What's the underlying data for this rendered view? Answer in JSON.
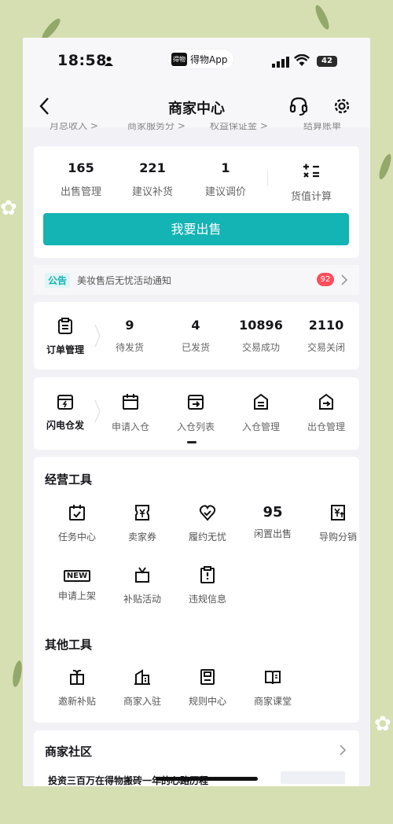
{
  "status_bar": {
    "time": "18:58",
    "app_label": "得物App",
    "app_logo": "得物",
    "battery": "42"
  },
  "nav": {
    "title": "商家中心"
  },
  "sublinks": [
    "月总收入 >",
    "商家服务分 >",
    "权益保证金 >",
    "结算账单"
  ],
  "stats": {
    "items": [
      {
        "value": "165",
        "label": "出售管理"
      },
      {
        "value": "221",
        "label": "建议补货"
      },
      {
        "value": "1",
        "label": "建议调价"
      }
    ],
    "calc_label": "货值计算",
    "primary_button": "我要出售"
  },
  "notice": {
    "tag": "公告",
    "text": "美妆售后无忧活动通知",
    "badge": "92"
  },
  "orders": {
    "label": "订单管理",
    "items": [
      {
        "value": "9",
        "label": "待发货"
      },
      {
        "value": "4",
        "label": "已发货"
      },
      {
        "value": "10896",
        "label": "交易成功"
      },
      {
        "value": "2110",
        "label": "交易关闭"
      }
    ]
  },
  "warehouse": {
    "label": "闪电仓发",
    "items": [
      "申请入仓",
      "入仓列表",
      "入仓管理",
      "出仓管理"
    ]
  },
  "business_tools": {
    "title": "经营工具",
    "items": [
      {
        "label": "任务中心",
        "icon": "task-icon"
      },
      {
        "label": "卖家券",
        "icon": "coupon-icon"
      },
      {
        "label": "履约无忧",
        "icon": "heart-shield-icon"
      },
      {
        "label": "闲置出售",
        "icon": "resale-95-icon",
        "icon_text": "95"
      },
      {
        "label": "导购分销",
        "icon": "distribution-icon"
      },
      {
        "label": "申请上架",
        "icon": "new-icon",
        "icon_text": "NEW"
      },
      {
        "label": "补贴活动",
        "icon": "subsidy-icon"
      },
      {
        "label": "违规信息",
        "icon": "violation-icon"
      }
    ]
  },
  "other_tools": {
    "title": "其他工具",
    "items": [
      {
        "label": "邀新补贴",
        "icon": "gift-icon"
      },
      {
        "label": "商家入驻",
        "icon": "building-icon"
      },
      {
        "label": "规则中心",
        "icon": "rules-icon"
      },
      {
        "label": "商家课堂",
        "icon": "book-icon"
      }
    ]
  },
  "community": {
    "title": "商家社区",
    "article": "投资三百万在得物搬砖一年的心路历程"
  },
  "colors": {
    "accent": "#14b3b4",
    "badge": "#ff4d5a",
    "background": "#d6dfb1"
  }
}
